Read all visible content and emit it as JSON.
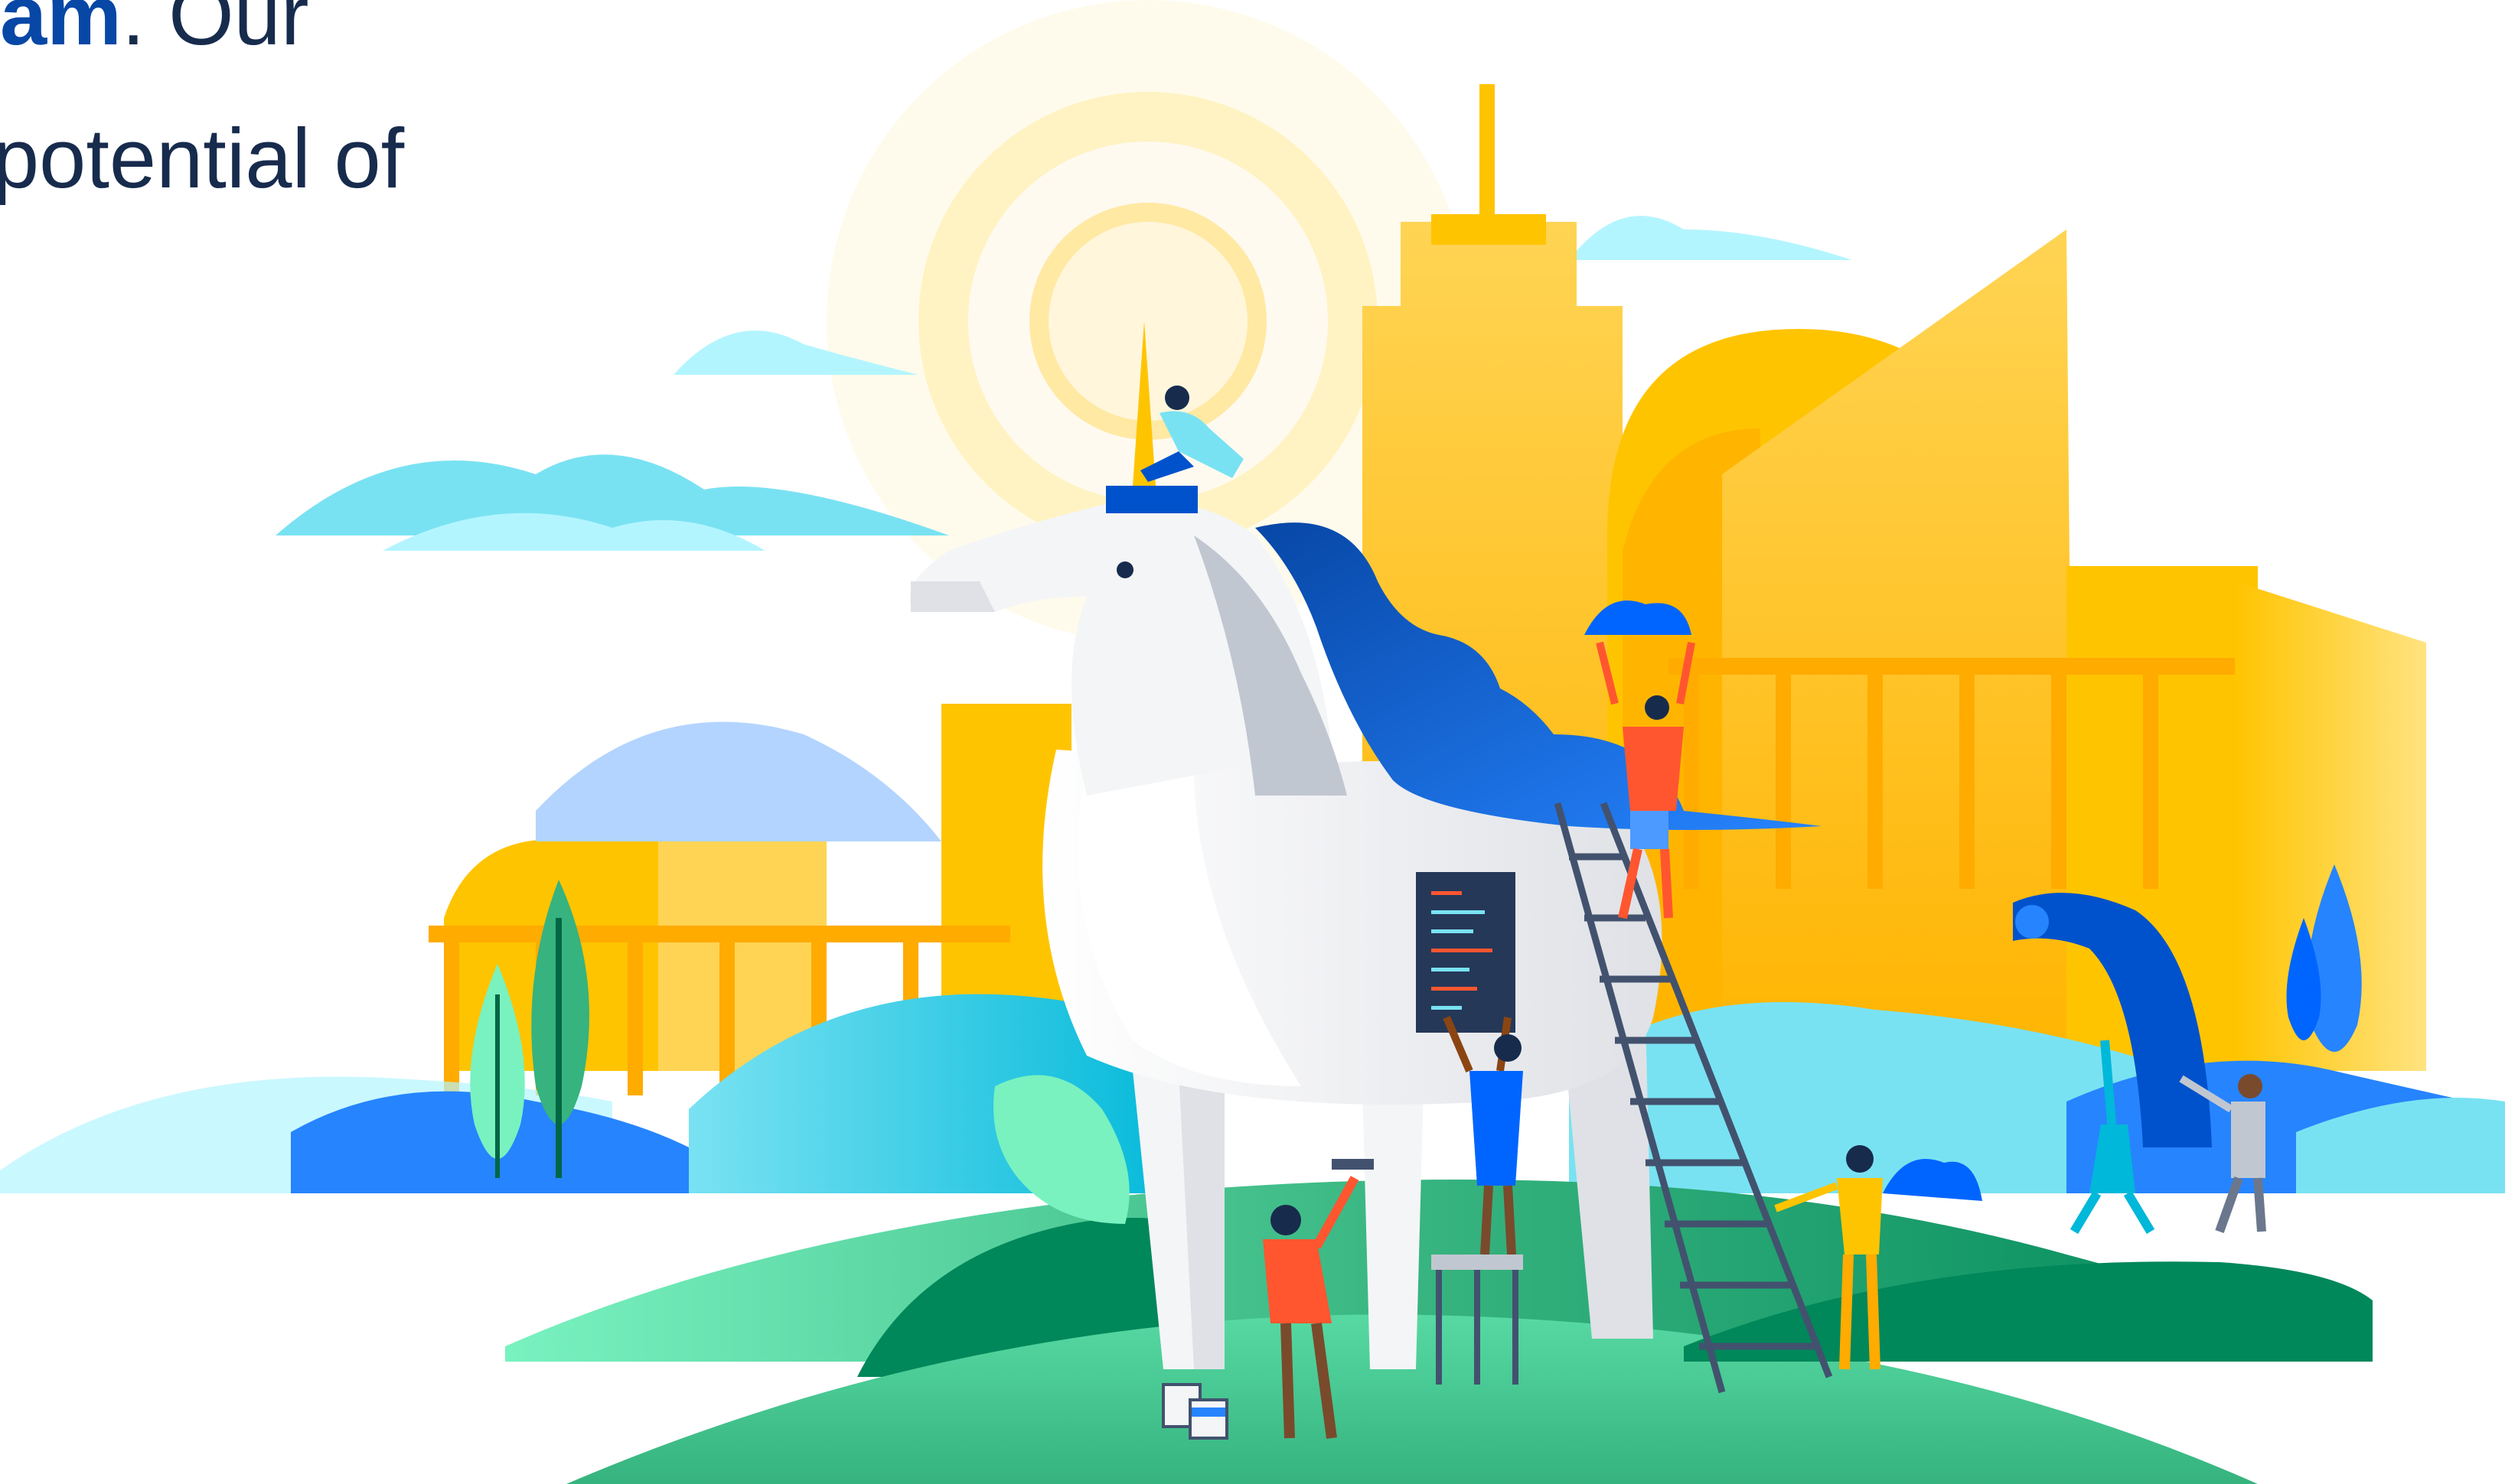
{
  "headline": {
    "line1_accent": "am",
    "line1_rest": ". Our",
    "line2": "potential of"
  },
  "illustration": {
    "subject": "unicorn-statue-with-team-building-it",
    "colors": {
      "sun_glow": "#fff4cc",
      "sun_core": "#ffd666",
      "city_gold": "#ffc400",
      "city_gold_dark": "#ffab00",
      "unicorn_white": "#f4f5f7",
      "unicorn_gray": "#c1c7d0",
      "mane_blue": "#0052cc",
      "mane_blue_light": "#2684ff",
      "cloud_light": "#b3f5ff",
      "cloud_teal": "#79e2f2",
      "hill_green": "#36b37e",
      "hill_green_dark": "#00875a",
      "hill_green_light": "#57d9a3",
      "ladder": "#42526e",
      "person_orange": "#ff5630",
      "person_blue": "#0065ff"
    }
  }
}
